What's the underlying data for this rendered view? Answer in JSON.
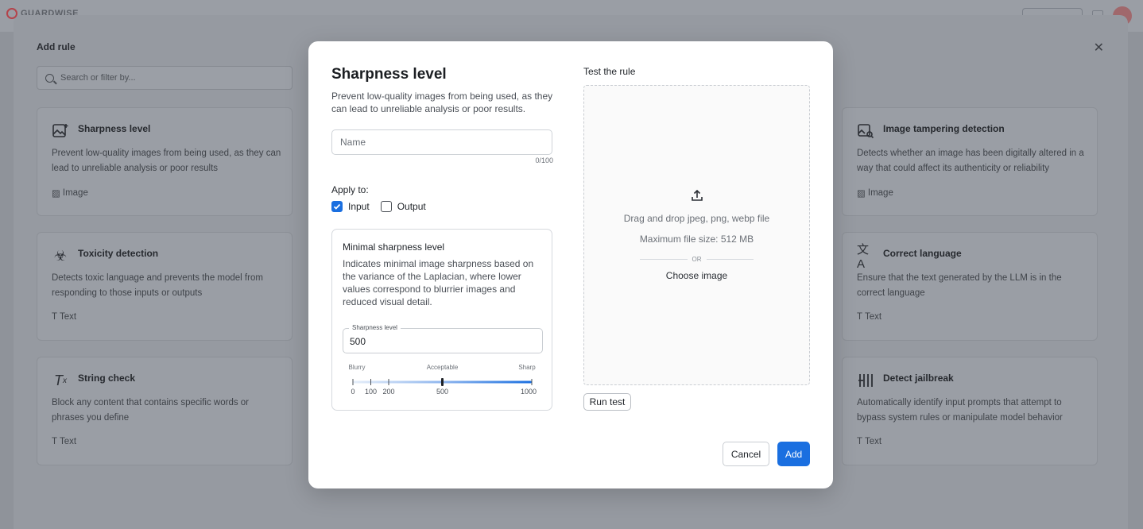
{
  "brand": {
    "name": "GUARDWISE"
  },
  "panel": {
    "title": "Add rule",
    "search_placeholder": "Search or filter by...",
    "cards": [
      {
        "id": "sharpness",
        "icon": "image-sparkle-icon",
        "title": "Sharpness level",
        "desc": "Prevent low-quality images from being used, as they can lead to unreliable analysis or poor results",
        "tag": "Image"
      },
      {
        "id": "toxicity",
        "icon": "biohazard-icon",
        "title": "Toxicity detection",
        "desc": "Detects toxic language and prevents the model from responding to those inputs or outputs",
        "tag": "Text"
      },
      {
        "id": "string",
        "icon": "clear-format-icon",
        "title": "String check",
        "desc": "Block any content that contains specific words or phrases you define",
        "tag": "Text"
      },
      {
        "id": "tampering",
        "icon": "image-search-icon",
        "title": "Image tampering detection",
        "desc": "Detects whether an image has been digitally altered in a way that could affect its authenticity or reliability",
        "tag": "Image"
      },
      {
        "id": "language",
        "icon": "translate-icon",
        "title": "Correct language",
        "desc": "Ensure that the text generated by the LLM is in the correct language",
        "tag": "Text"
      },
      {
        "id": "jailbreak",
        "icon": "jail-bars-icon",
        "title": "Detect jailbreak",
        "desc": "Automatically identify input prompts that attempt to bypass system rules or manipulate model behavior",
        "tag": "Text"
      }
    ]
  },
  "modal": {
    "title": "Sharpness level",
    "description": "Prevent low-quality images from being used, as they can lead to unreliable analysis or poor results.",
    "name_placeholder": "Name",
    "name_value": "",
    "char_counter": "0/100",
    "apply_to_label": "Apply to:",
    "apply_options": [
      {
        "label": "Input",
        "checked": true
      },
      {
        "label": "Output",
        "checked": false
      }
    ],
    "setting": {
      "title": "Minimal sharpness level",
      "description": "Indicates minimal image sharpness based on the variance of the Laplacian, where lower values correspond to blurrier images and reduced visual detail.",
      "field_label": "Sharpness level",
      "value": "500",
      "slider": {
        "min": 0,
        "max": 1000,
        "value": 500,
        "zones": [
          "Blurry",
          "Acceptable",
          "Sharp"
        ],
        "ticks": [
          0,
          100,
          200,
          500,
          1000
        ]
      }
    },
    "test": {
      "title": "Test the rule",
      "drop_text": "Drag and drop jpeg, png, webp file",
      "max_size": "Maximum file size: 512 MB",
      "or": "OR",
      "choose": "Choose image",
      "run_label": "Run test"
    },
    "cancel_label": "Cancel",
    "add_label": "Add"
  },
  "colors": {
    "accent": "#1a6fe0",
    "overlay": "#8f939a"
  }
}
